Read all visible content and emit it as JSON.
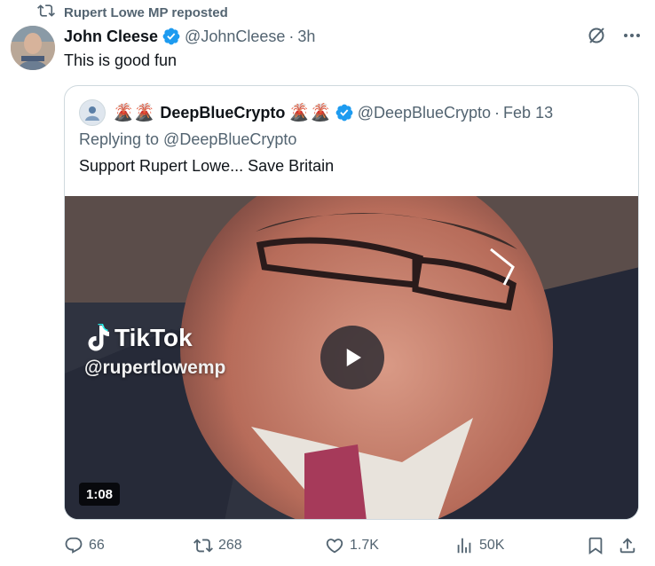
{
  "repost": {
    "text": "Rupert Lowe MP reposted"
  },
  "tweet": {
    "display_name": "John Cleese",
    "handle": "@JohnCleese",
    "separator": "·",
    "time": "3h",
    "text": "This is good fun"
  },
  "quote": {
    "display_name": "DeepBlueCrypto",
    "name_emoji_left": "🌋🌋",
    "name_emoji_right": "🌋🌋",
    "handle": "@DeepBlueCrypto",
    "separator": "·",
    "date": "Feb 13",
    "replying_to": "Replying to @DeepBlueCrypto",
    "text": "Support Rupert Lowe... Save Britain",
    "video": {
      "watermark_brand": "TikTok",
      "watermark_handle": "@rupertlowemp",
      "duration": "1:08"
    }
  },
  "actions": {
    "replies": "66",
    "reposts": "268",
    "likes": "1.7K",
    "views": "50K"
  },
  "colors": {
    "verified": "#1d9bf0",
    "secondary_text": "#536471",
    "border": "#cfd9de"
  }
}
